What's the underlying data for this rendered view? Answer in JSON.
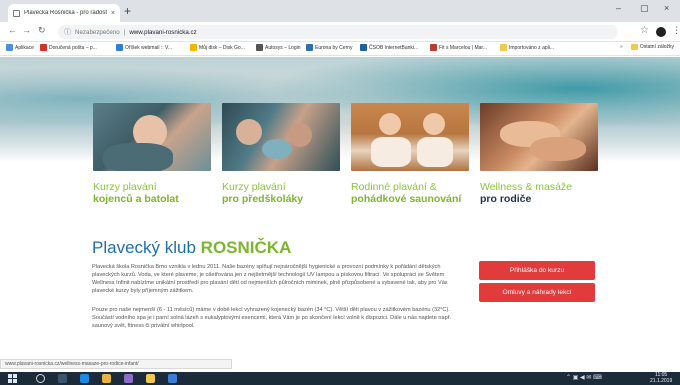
{
  "browser": {
    "tab_title": "Plavecká Rosnička - pro radost z ...",
    "tab_close": "×",
    "new_tab": "+",
    "window_controls": [
      "–",
      "▢",
      "×"
    ],
    "security_label": "Nezabezpečeno",
    "url": "www.plavani-rosnicka.cz",
    "bookmarks": [
      {
        "label": "Aplikace",
        "color": "#4a90e2"
      },
      {
        "label": "Doručená pošta – p...",
        "color": "#d93025"
      },
      {
        "label": "Oříšek webmail :: V...",
        "color": "#2f7fd8"
      },
      {
        "label": "Můj disk – Disk Go...",
        "color": "#f4b400"
      },
      {
        "label": "Autosys – Login",
        "color": "#555555"
      },
      {
        "label": "Eurona by Cerny",
        "color": "#2c6fb7"
      },
      {
        "label": "ČSOB InternetBanki...",
        "color": "#1d5fa8"
      },
      {
        "label": "Fit s Marcelou | Mar...",
        "color": "#c0392b"
      },
      {
        "label": "Importováno z apli...",
        "color": "#f2c94c"
      }
    ],
    "bookmarks_other": "Ostatní záložky",
    "status_url": "www.plavani-rosnicka.cz/wellness-masaze-pro-rodice-infant/"
  },
  "site": {
    "cards": [
      {
        "line1": "Kurzy plavání",
        "line2": "kojenců a batolat"
      },
      {
        "line1": "Kurzy plavání",
        "line2": "pro předškoláky"
      },
      {
        "line1": "Rodinné plavání &",
        "line2": "pohádkové saunování"
      },
      {
        "line1": "Wellness & masáže",
        "line2": "pro rodiče"
      }
    ],
    "title_prefix": "Plavecký klub",
    "title_accent": "ROSNIČKA",
    "paragraph1": "Plavecká škola Rosnička Brno vznikla v lednu 2011. Naše bazény splňují nejnáročnější hygienické a provozní podmínky k pořádání dětských plaveckých kurzů. Voda, ve které plaveme, je ošetřována jen z nejšetrnější technologií UV lampou a pískovou filtrací. Ve spolupráci se Světem Wellness Infinit nabízíme unikátní prostředí pro plavání dětí od nejmenších půlročních miminek, plně přizpůsobené a vybavené tak, aby pro Vás plavecké kurzy byly příjemným zážitkem.",
    "paragraph2": "Pouze pro naše nejmenší (6 - 11 měsíců) máme v době lekcí vyhrazený kojenecký bazén (34 °C). Větší děti plavou v zážitkovém bazénu (32°C). Součástí vodního spa je i parní solná lázeň s eukalyptovými esencemi, která Vám je po skončení lekcí volně k dispozici. Dále u nás najdete např. saunový svět, fitness či privátní whirlpool.",
    "button_signup": "Přihláška do kurzu",
    "button_excuses": "Omluvy a náhrady lekcí"
  },
  "taskbar": {
    "time": "11:05",
    "date": "21.1.2019"
  },
  "colors": {
    "brand_blue": "#1f6fb0",
    "brand_green": "#7bb72e",
    "button_red": "#e23b3b"
  }
}
